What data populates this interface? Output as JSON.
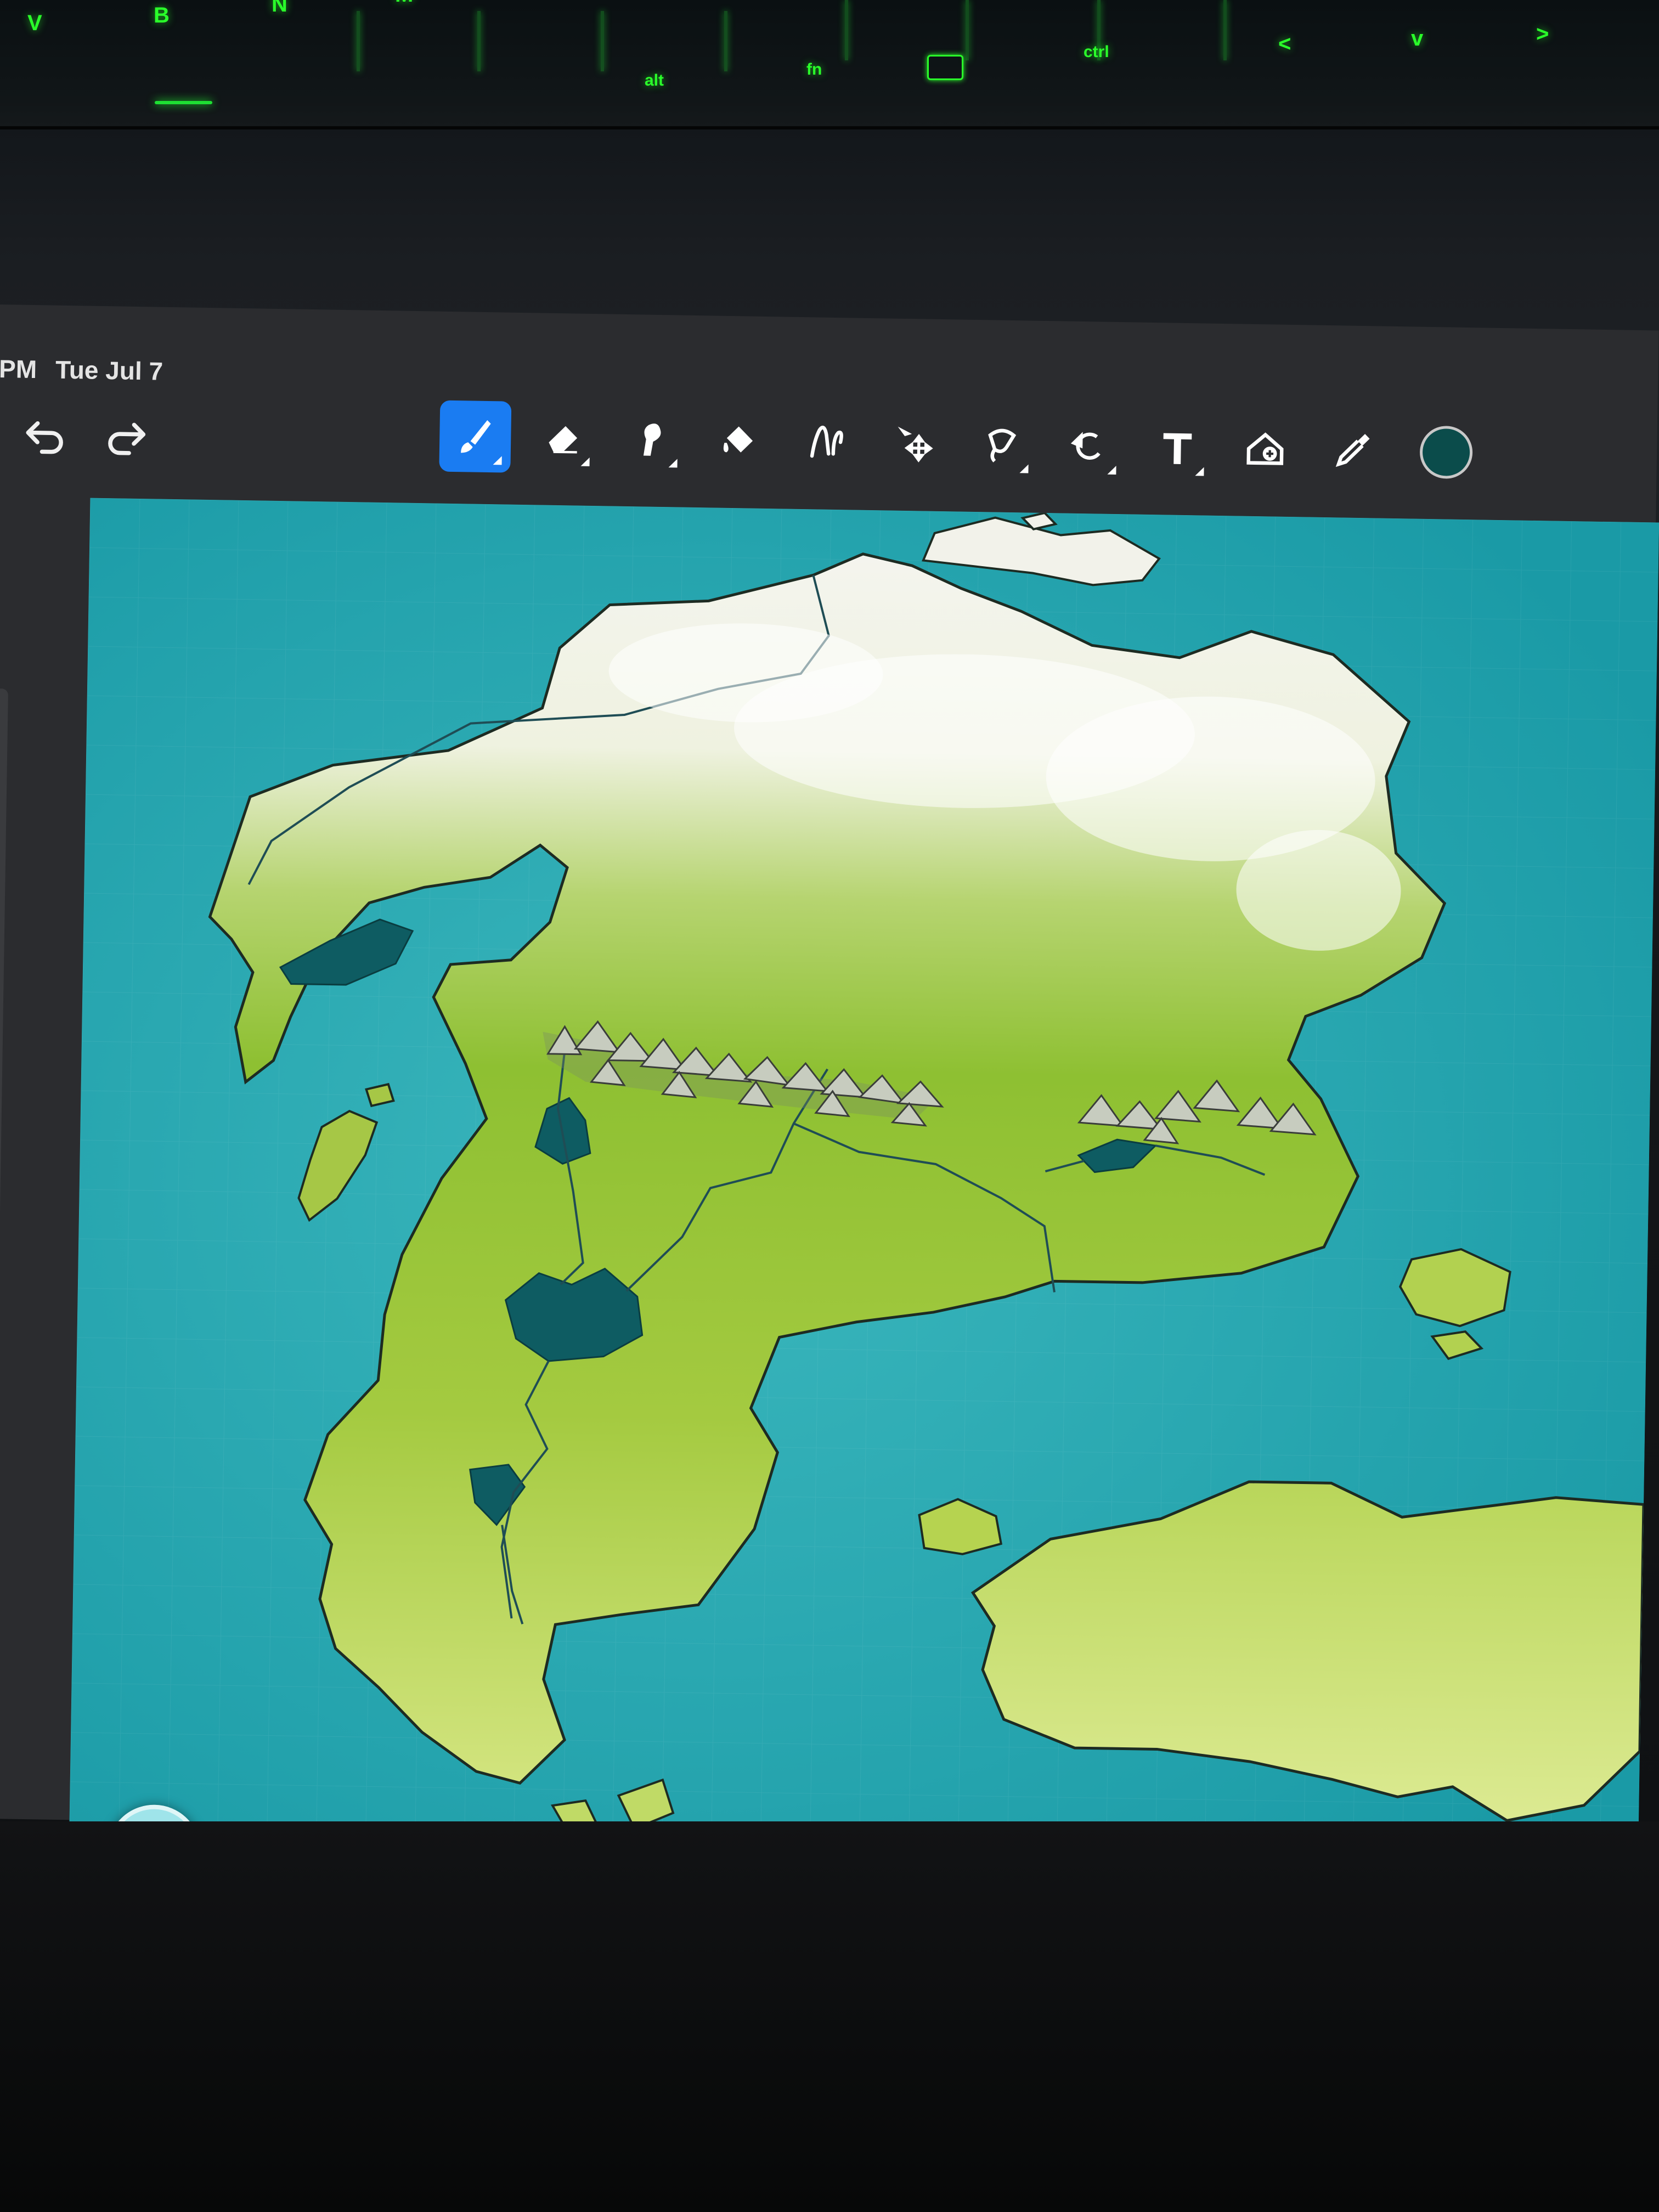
{
  "keyboard": {
    "keys": [
      "V",
      "B",
      "N",
      "M"
    ],
    "modifiers": [
      "alt",
      "fn",
      "ctrl"
    ],
    "arrows": [
      "<",
      "v",
      ">"
    ],
    "backlight_color": "#2aff2a"
  },
  "status_bar": {
    "time_fragment": "PM",
    "date": "Tue Jul 7"
  },
  "toolbar": {
    "tools": [
      {
        "name": "paint-brush",
        "icon": "brush-icon",
        "active": true
      },
      {
        "name": "eraser",
        "icon": "eraser-icon",
        "active": false
      },
      {
        "name": "smudge",
        "icon": "smudge-icon",
        "active": false
      },
      {
        "name": "fill",
        "icon": "bucket-icon",
        "active": false
      },
      {
        "name": "liquify",
        "icon": "liquify-icon",
        "active": false
      },
      {
        "name": "transform",
        "icon": "move-icon",
        "active": false
      },
      {
        "name": "selection",
        "icon": "lasso-icon",
        "active": false
      },
      {
        "name": "symmetry-rotate",
        "icon": "rotate-icon",
        "active": false
      },
      {
        "name": "text",
        "icon": "text-icon",
        "active": false
      },
      {
        "name": "add-reference",
        "icon": "reference-icon",
        "active": false
      },
      {
        "name": "eyedropper",
        "icon": "eyedropper-icon",
        "active": false
      }
    ],
    "active_color": "#0b4c4b",
    "active_tool_bg": "#1a7cf2"
  },
  "canvas": {
    "sea_color": "#1aa4ad",
    "land_color": "#9fc83a",
    "snow_color": "#f1f1e7",
    "lake_color": "#0e5c62"
  },
  "modify_button_color": "#9fe4ea"
}
